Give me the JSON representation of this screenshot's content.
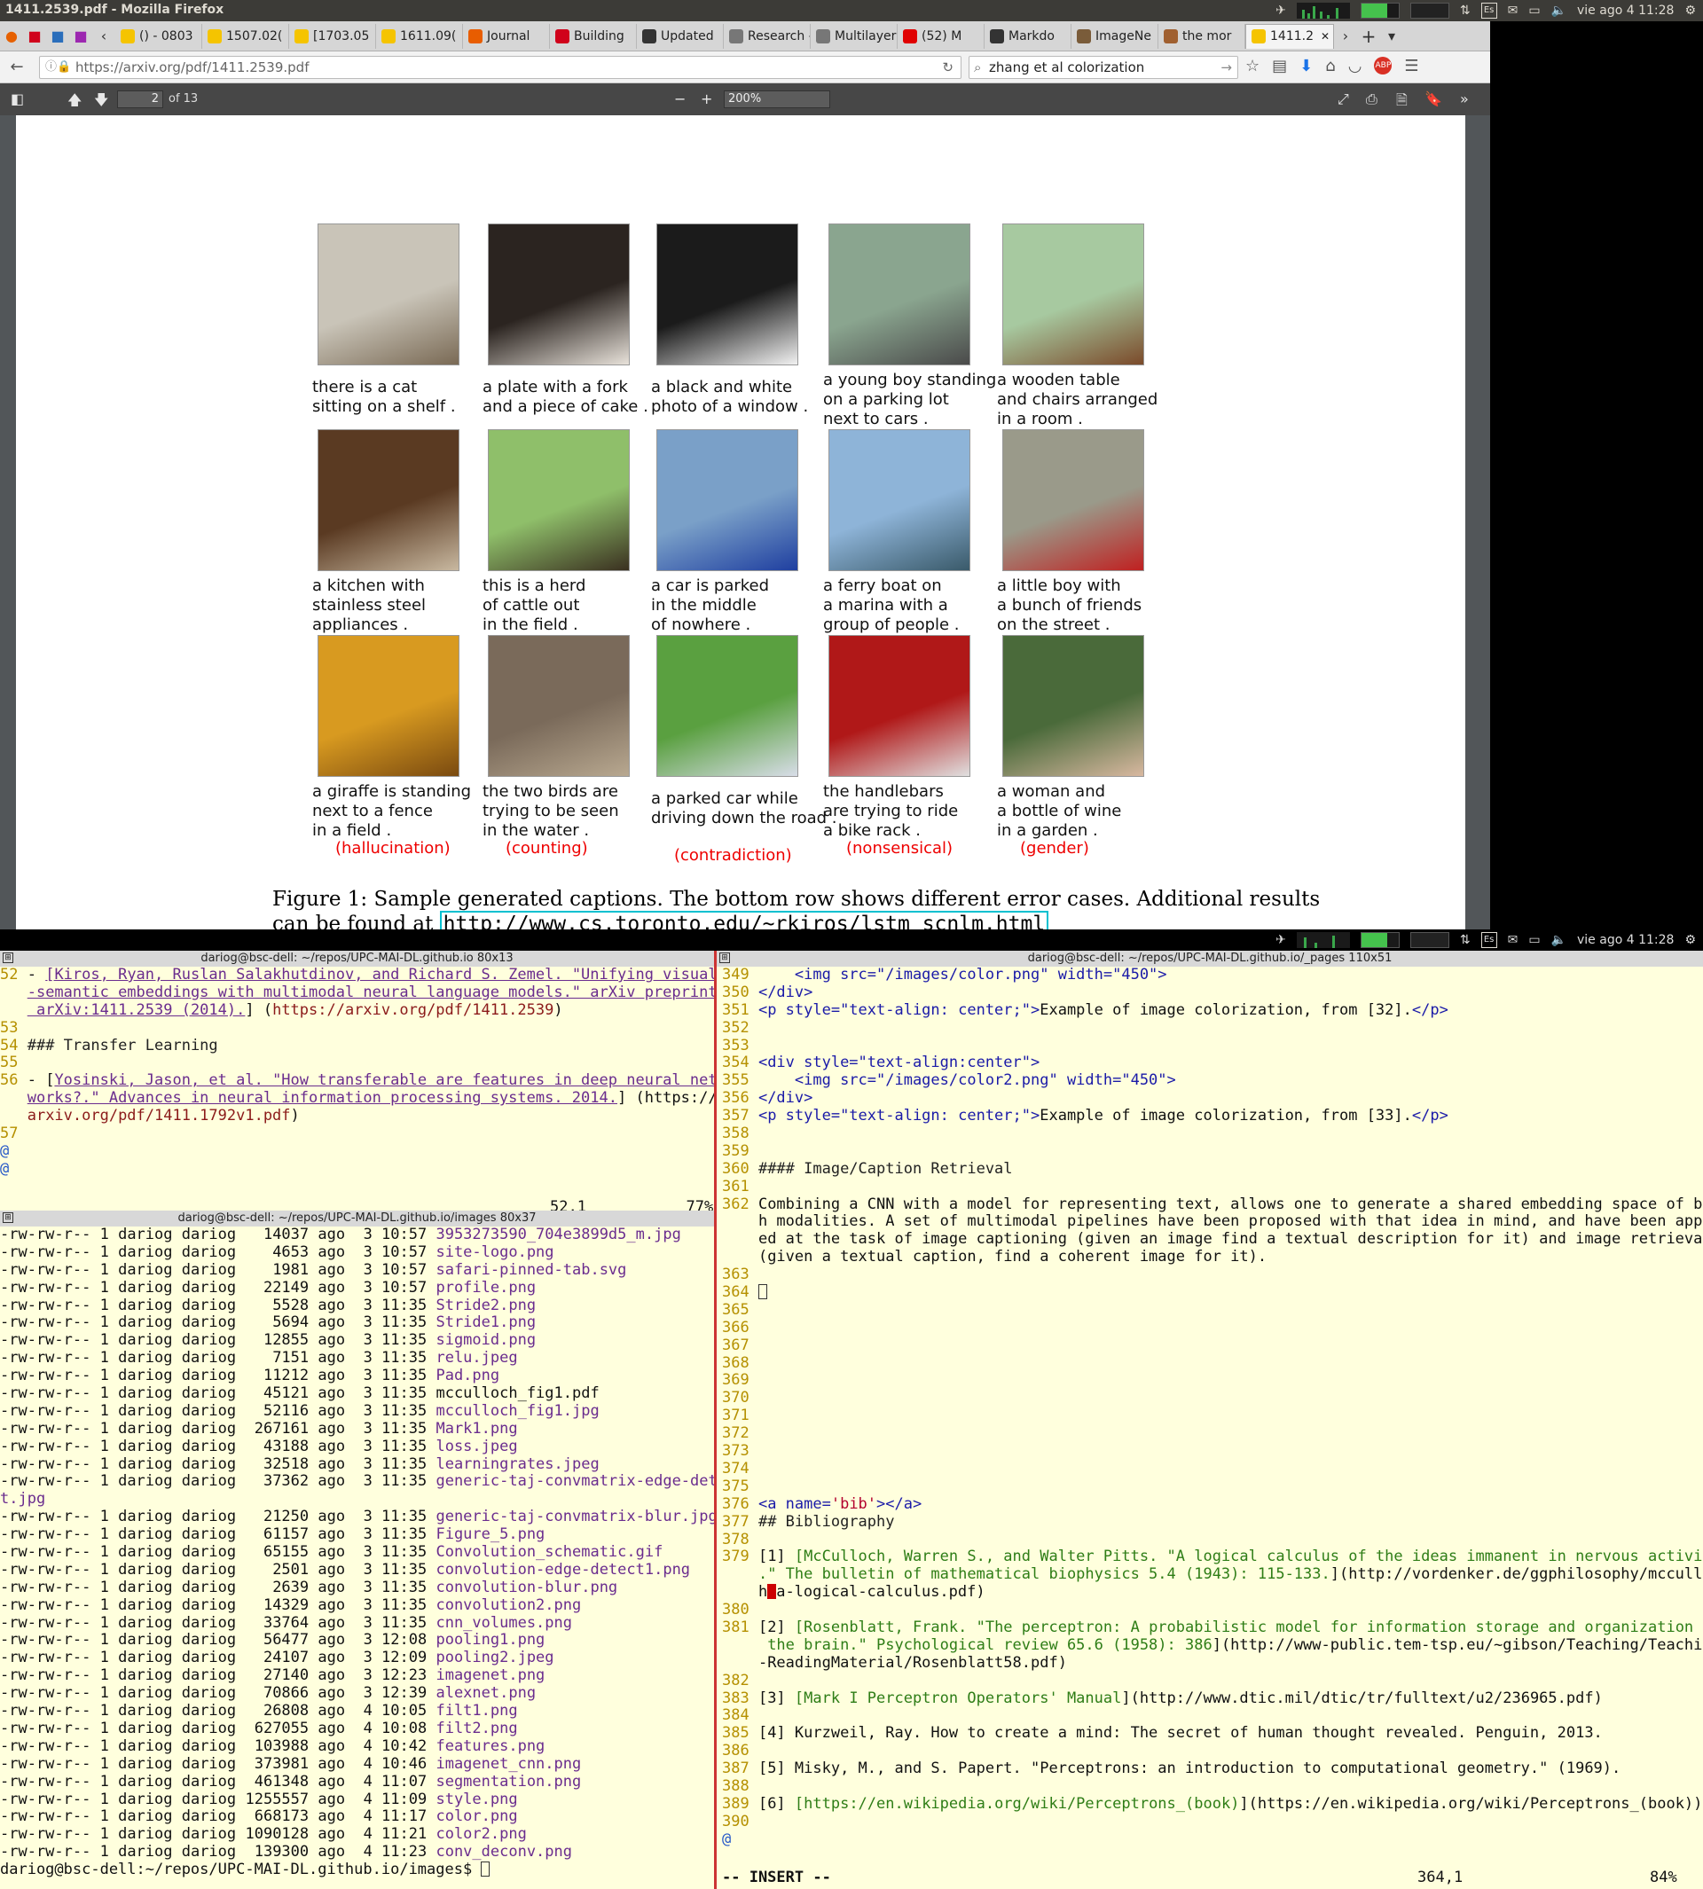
{
  "topbar": {
    "window_title": "1411.2539.pdf - Mozilla Firefox",
    "keyboard": "Es",
    "clock": "vie ago  4 11:28"
  },
  "tabs": [
    {
      "label": "() - 0803",
      "color": "#f5c400"
    },
    {
      "label": "1507.02(",
      "color": "#f5c400"
    },
    {
      "label": "[1703.05",
      "color": "#f5c400"
    },
    {
      "label": "1611.09(",
      "color": "#f5c400"
    },
    {
      "label": "Journal",
      "color": "#e85d00"
    },
    {
      "label": "Building",
      "color": "#d0021b"
    },
    {
      "label": "Updated",
      "color": "#333333"
    },
    {
      "label": "Research –",
      "color": "#777777"
    },
    {
      "label": "Multilayer P",
      "color": "#777777"
    },
    {
      "label": "(52) M",
      "color": "#e00000"
    },
    {
      "label": "Markdo",
      "color": "#333333"
    },
    {
      "label": "ImageNe",
      "color": "#7a5c3a"
    },
    {
      "label": "the mor",
      "color": "#a06030"
    },
    {
      "label": "1411.2",
      "color": "#f5c400"
    }
  ],
  "navbar": {
    "url": "https://arxiv.org/pdf/1411.2539.pdf",
    "search": "zhang et al colorization"
  },
  "pdf_toolbar": {
    "page": "2",
    "page_count": "of 13",
    "zoom": "200%"
  },
  "figure": {
    "rows": [
      [
        {
          "caption": [
            "there is a cat",
            "sitting on a shelf ."
          ]
        },
        {
          "caption": [
            "a plate with a fork",
            "and a piece of cake ."
          ]
        },
        {
          "caption": [
            "a black and white",
            "photo of a window ."
          ]
        },
        {
          "caption": [
            "a young boy standing",
            "on a parking lot",
            "next to cars ."
          ]
        },
        {
          "caption": [
            "a wooden table",
            "and chairs arranged",
            "in a room ."
          ]
        }
      ],
      [
        {
          "caption": [
            "a kitchen with",
            "stainless steel",
            "appliances ."
          ]
        },
        {
          "caption": [
            "this is a herd",
            "of cattle out",
            "in the field ."
          ]
        },
        {
          "caption": [
            "a car is parked",
            "in the middle",
            "of nowhere ."
          ]
        },
        {
          "caption": [
            "a ferry boat on",
            "a marina with a",
            "group of people ."
          ]
        },
        {
          "caption": [
            "a little boy with",
            "a bunch of friends",
            "on the street ."
          ]
        }
      ],
      [
        {
          "caption": [
            "a giraffe is standing",
            "next to a fence",
            "in a field ."
          ],
          "error": "(hallucination)"
        },
        {
          "caption": [
            "the two birds are",
            "trying to be seen",
            "in the water ."
          ],
          "error": "(counting)"
        },
        {
          "caption": [
            "a parked car while",
            "driving down the road ."
          ],
          "error": "(contradiction)"
        },
        {
          "caption": [
            "the handlebars",
            "are trying to ride",
            "a bike rack ."
          ],
          "error": "(nonsensical)"
        },
        {
          "caption": [
            "a woman and",
            "a bottle of wine",
            "in a garden ."
          ],
          "error": "(gender)"
        }
      ]
    ],
    "caption_line1": "Figure 1: Sample generated captions.  The bottom row shows different error cases.  Additional results",
    "caption_line2_prefix": "can be found at ",
    "caption_link": "http://www.cs.toronto.edu/~rkiros/lstm_scnlm.html"
  },
  "term_top_left": {
    "title": "dariog@bsc-dell: ~/repos/UPC-MAI-DL.github.io 80x13",
    "lines": [
      [
        [
          "52 ",
          "num"
        ],
        [
          "- ",
          ""
        ],
        [
          "[Kiros, Ryan, Ruslan Salakhutdinov, and Richard S. Zemel. \"Unifying visual",
          "lnk"
        ]
      ],
      [
        [
          "   ",
          ""
        ],
        [
          "-semantic embeddings with multimodal neural language models.\" arXiv preprint",
          "lnk"
        ]
      ],
      [
        [
          "   ",
          ""
        ],
        [
          " arXiv:1411.2539 (2014).",
          "lnk"
        ],
        [
          "] (",
          ""
        ],
        [
          "https://arxiv.org/pdf/1411.2539",
          "url"
        ],
        [
          ")",
          ""
        ]
      ],
      [
        [
          "53",
          "num"
        ]
      ],
      [
        [
          "54 ",
          "num"
        ],
        [
          "### Transfer Learning",
          "hdr"
        ]
      ],
      [
        [
          "55",
          "num"
        ]
      ],
      [
        [
          "56 ",
          "num"
        ],
        [
          "- [",
          ""
        ],
        [
          "Yosinski, Jason, et al. \"How transferable are features in deep neural net",
          "lnk"
        ]
      ],
      [
        [
          "   ",
          ""
        ],
        [
          "works?.\" Advances in neural information processing systems. 2014.",
          "lnk"
        ],
        [
          "] (https://",
          ""
        ]
      ],
      [
        [
          "   ",
          ""
        ],
        [
          "arxiv.org/pdf/1411.1792v1.pdf",
          "url"
        ],
        [
          ")",
          ""
        ]
      ],
      [
        [
          "57",
          "num"
        ]
      ],
      [
        [
          "@",
          "at"
        ]
      ],
      [
        [
          "@",
          "at"
        ]
      ]
    ],
    "status": "52,1           77%"
  },
  "term_files": {
    "title": "dariog@bsc-dell: ~/repos/UPC-MAI-DL.github.io/images 80x37",
    "perm": "-rw-rw-r--",
    "owner": "1 dariog dariog",
    "files": [
      {
        "size": "14037",
        "date": "ago  3 10:57",
        "name": "3953273590_704e3899d5_m.jpg"
      },
      {
        "size": "4653",
        "date": "ago  3 10:57",
        "name": "site-logo.png"
      },
      {
        "size": "1981",
        "date": "ago  3 10:57",
        "name": "safari-pinned-tab.svg"
      },
      {
        "size": "22149",
        "date": "ago  3 10:57",
        "name": "profile.png"
      },
      {
        "size": "5528",
        "date": "ago  3 11:35",
        "name": "Stride2.png"
      },
      {
        "size": "5694",
        "date": "ago  3 11:35",
        "name": "Stride1.png"
      },
      {
        "size": "12855",
        "date": "ago  3 11:35",
        "name": "sigmoid.png"
      },
      {
        "size": "7151",
        "date": "ago  3 11:35",
        "name": "relu.jpeg"
      },
      {
        "size": "11212",
        "date": "ago  3 11:35",
        "name": "Pad.png"
      },
      {
        "size": "45121",
        "date": "ago  3 11:35",
        "name": "mcculloch_fig1.pdf",
        "plain": true
      },
      {
        "size": "52116",
        "date": "ago  3 11:35",
        "name": "mcculloch_fig1.jpg"
      },
      {
        "size": "267161",
        "date": "ago  3 11:35",
        "name": "Mark1.png"
      },
      {
        "size": "43188",
        "date": "ago  3 11:35",
        "name": "loss.jpeg"
      },
      {
        "size": "32518",
        "date": "ago  3 11:35",
        "name": "learningrates.jpeg"
      },
      {
        "size": "37362",
        "date": "ago  3 11:35",
        "name": "generic-taj-convmatrix-edge-dete",
        "wrap": "t.jpg"
      },
      {
        "size": "21250",
        "date": "ago  3 11:35",
        "name": "generic-taj-convmatrix-blur.jpg"
      },
      {
        "size": "61157",
        "date": "ago  3 11:35",
        "name": "Figure_5.png"
      },
      {
        "size": "65155",
        "date": "ago  3 11:35",
        "name": "Convolution_schematic.gif"
      },
      {
        "size": "2501",
        "date": "ago  3 11:35",
        "name": "convolution-edge-detect1.png"
      },
      {
        "size": "2639",
        "date": "ago  3 11:35",
        "name": "convolution-blur.png"
      },
      {
        "size": "14329",
        "date": "ago  3 11:35",
        "name": "convolution2.png"
      },
      {
        "size": "33764",
        "date": "ago  3 11:35",
        "name": "cnn_volumes.png"
      },
      {
        "size": "56477",
        "date": "ago  3 12:08",
        "name": "pooling1.png"
      },
      {
        "size": "24107",
        "date": "ago  3 12:09",
        "name": "pooling2.jpeg"
      },
      {
        "size": "27140",
        "date": "ago  3 12:23",
        "name": "imagenet.png"
      },
      {
        "size": "70866",
        "date": "ago  3 12:39",
        "name": "alexnet.png"
      },
      {
        "size": "26808",
        "date": "ago  4 10:05",
        "name": "filt1.png"
      },
      {
        "size": "627055",
        "date": "ago  4 10:08",
        "name": "filt2.png"
      },
      {
        "size": "103988",
        "date": "ago  4 10:42",
        "name": "features.png"
      },
      {
        "size": "373981",
        "date": "ago  4 10:46",
        "name": "imagenet_cnn.png"
      },
      {
        "size": "461348",
        "date": "ago  4 11:07",
        "name": "segmentation.png"
      },
      {
        "size": "1255557",
        "date": "ago  4 11:09",
        "name": "style.png"
      },
      {
        "size": "668173",
        "date": "ago  4 11:17",
        "name": "color.png"
      },
      {
        "size": "1090128",
        "date": "ago  4 11:21",
        "name": "color2.png"
      },
      {
        "size": "139300",
        "date": "ago  4 11:23",
        "name": "conv_deconv.png"
      }
    ],
    "prompt": "dariog@bsc-dell:~/repos/UPC-MAI-DL.github.io/images$ "
  },
  "term_vim": {
    "title": "dariog@bsc-dell: ~/repos/UPC-MAI-DL.github.io/_pages 110x51",
    "lines": [
      [
        [
          "349 ",
          "num"
        ],
        [
          "    <img src=\"/images/color.png\" width=\"450\">",
          "tag"
        ]
      ],
      [
        [
          "350 ",
          "num"
        ],
        [
          "</div>",
          "tag"
        ]
      ],
      [
        [
          "351 ",
          "num"
        ],
        [
          "<p style=\"text-align: center;\">",
          "tag"
        ],
        [
          "Example of image colorization, from [32].",
          ""
        ],
        [
          "</p>",
          "tag"
        ]
      ],
      [
        [
          "352",
          "num"
        ]
      ],
      [
        [
          "353",
          "num"
        ]
      ],
      [
        [
          "354 ",
          "num"
        ],
        [
          "<div style=\"text-align:center\">",
          "tag"
        ]
      ],
      [
        [
          "355 ",
          "num"
        ],
        [
          "    <img src=\"/images/color2.png\" width=\"450\">",
          "tag"
        ]
      ],
      [
        [
          "356 ",
          "num"
        ],
        [
          "</div>",
          "tag"
        ]
      ],
      [
        [
          "357 ",
          "num"
        ],
        [
          "<p style=\"text-align: center;\">",
          "tag"
        ],
        [
          "Example of image colorization, from [33].",
          ""
        ],
        [
          "</p>",
          "tag"
        ]
      ],
      [
        [
          "358",
          "num"
        ]
      ],
      [
        [
          "359",
          "num"
        ]
      ],
      [
        [
          "360 ",
          "num"
        ],
        [
          "#### Image/Caption Retrieval",
          "hdr"
        ]
      ],
      [
        [
          "361",
          "num"
        ]
      ],
      [
        [
          "362 ",
          "num"
        ],
        [
          "Combining a CNN with a model for representing text, allows one to generate a shared embedding space of bot",
          ""
        ]
      ],
      [
        [
          "    ",
          ""
        ],
        [
          "h modalities. A set of multimodal pipelines have been proposed with that idea in mind, and have been appli",
          ""
        ]
      ],
      [
        [
          "    ",
          ""
        ],
        [
          "ed at the task of image captioning (given an image find a textual description for it) and image retrieval",
          ""
        ]
      ],
      [
        [
          "    ",
          ""
        ],
        [
          "(given a textual caption, find a coherent image for it).",
          ""
        ]
      ],
      [
        [
          "363",
          "num"
        ]
      ],
      [
        [
          "364 ",
          "num"
        ],
        [
          "CURSOR",
          "cursor"
        ]
      ],
      [
        [
          "365",
          "num"
        ]
      ],
      [
        [
          "366",
          "num"
        ]
      ],
      [
        [
          "367",
          "num"
        ]
      ],
      [
        [
          "368",
          "num"
        ]
      ],
      [
        [
          "369",
          "num"
        ]
      ],
      [
        [
          "370",
          "num"
        ]
      ],
      [
        [
          "371",
          "num"
        ]
      ],
      [
        [
          "372",
          "num"
        ]
      ],
      [
        [
          "373",
          "num"
        ]
      ],
      [
        [
          "374",
          "num"
        ]
      ],
      [
        [
          "375",
          "num"
        ]
      ],
      [
        [
          "376 ",
          "num"
        ],
        [
          "<a name=",
          "tag"
        ],
        [
          "'bib'",
          "str"
        ],
        [
          "></a>",
          "tag"
        ]
      ],
      [
        [
          "377 ",
          "num"
        ],
        [
          "## Bibliography",
          "hdr"
        ]
      ],
      [
        [
          "378",
          "num"
        ]
      ],
      [
        [
          "379 ",
          "num"
        ],
        [
          "[1] ",
          ""
        ],
        [
          "[McCulloch, Warren S., and Walter Pitts. \"A logical calculus of the ideas immanent in nervous activity",
          "grn"
        ]
      ],
      [
        [
          "    ",
          ""
        ],
        [
          ".\" The bulletin of mathematical biophysics 5.4 (1943): 115-133.",
          "grn"
        ],
        [
          "](http://vordenker.de/ggphilosophy/mcculloc",
          ""
        ]
      ],
      [
        [
          "    ",
          ""
        ],
        [
          "h",
          ""
        ],
        [
          "REDCURSOR",
          "cursor-red"
        ],
        [
          "a-logical-calculus.pdf)",
          ""
        ]
      ],
      [
        [
          "380",
          "num"
        ]
      ],
      [
        [
          "381 ",
          "num"
        ],
        [
          "[2] ",
          ""
        ],
        [
          "[Rosenblatt, Frank. \"The perceptron: A probabilistic model for information storage and organization in",
          "grn"
        ]
      ],
      [
        [
          "    ",
          ""
        ],
        [
          " the brain.\" Psychological review 65.6 (1958): 386",
          "grn"
        ],
        [
          "](http://www-public.tem-tsp.eu/~gibson/Teaching/Teaching",
          ""
        ]
      ],
      [
        [
          "    ",
          ""
        ],
        [
          "-ReadingMaterial/Rosenblatt58.pdf)",
          ""
        ]
      ],
      [
        [
          "382",
          "num"
        ]
      ],
      [
        [
          "383 ",
          "num"
        ],
        [
          "[3] ",
          ""
        ],
        [
          "[Mark I Perceptron Operators' Manual",
          "grn"
        ],
        [
          "](http://www.dtic.mil/dtic/tr/fulltext/u2/236965.pdf)",
          ""
        ]
      ],
      [
        [
          "384",
          "num"
        ]
      ],
      [
        [
          "385 ",
          "num"
        ],
        [
          "[4] Kurzweil, Ray. How to create a mind: The secret of human thought revealed. Penguin, 2013.",
          ""
        ]
      ],
      [
        [
          "386",
          "num"
        ]
      ],
      [
        [
          "387 ",
          "num"
        ],
        [
          "[5] Misky, M., and S. Papert. \"Perceptrons: an introduction to computational geometry.\" (1969).",
          ""
        ]
      ],
      [
        [
          "388",
          "num"
        ]
      ],
      [
        [
          "389 ",
          "num"
        ],
        [
          "[6] ",
          ""
        ],
        [
          "[https://en.wikipedia.org/wiki/Perceptrons_(book)",
          "grn"
        ],
        [
          "](https://en.wikipedia.org/wiki/Perceptrons_(book))",
          ""
        ]
      ],
      [
        [
          "390",
          "num"
        ]
      ],
      [
        [
          "@",
          "at"
        ]
      ]
    ],
    "mode": "-- INSERT --",
    "position": "364,1",
    "percent": "84%"
  },
  "colors": {
    "accent_link": "#00c0d0",
    "error_red": "#e00000",
    "terminal_bg": "#ffffdd"
  }
}
